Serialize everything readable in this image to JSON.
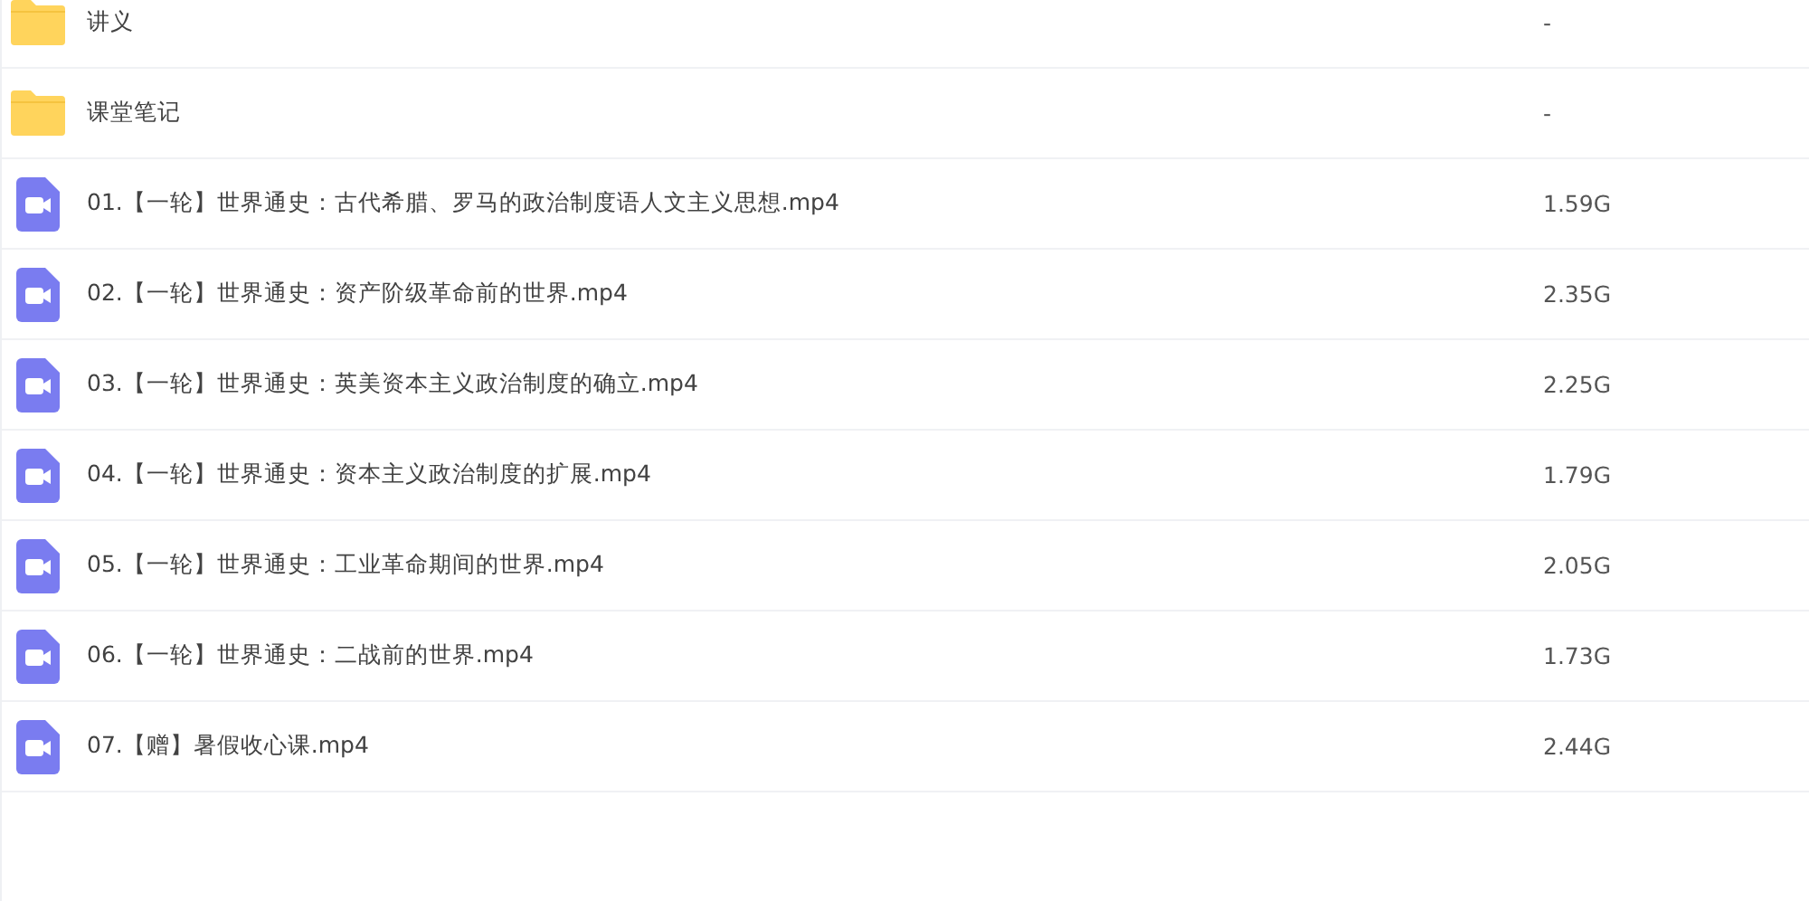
{
  "files": [
    {
      "kind": "folder",
      "name": "讲义",
      "size": "-"
    },
    {
      "kind": "folder",
      "name": "课堂笔记",
      "size": "-"
    },
    {
      "kind": "video",
      "name": "01.【一轮】世界通史：古代希腊、罗马的政治制度语人文主义思想.mp4",
      "size": "1.59G"
    },
    {
      "kind": "video",
      "name": "02.【一轮】世界通史：资产阶级革命前的世界.mp4",
      "size": "2.35G"
    },
    {
      "kind": "video",
      "name": "03.【一轮】世界通史：英美资本主义政治制度的确立.mp4",
      "size": "2.25G"
    },
    {
      "kind": "video",
      "name": "04.【一轮】世界通史：资本主义政治制度的扩展.mp4",
      "size": "1.79G"
    },
    {
      "kind": "video",
      "name": "05.【一轮】世界通史：工业革命期间的世界.mp4",
      "size": "2.05G"
    },
    {
      "kind": "video",
      "name": "06.【一轮】世界通史：二战前的世界.mp4",
      "size": "1.73G"
    },
    {
      "kind": "video",
      "name": "07.【赠】暑假收心课.mp4",
      "size": "2.44G"
    }
  ]
}
